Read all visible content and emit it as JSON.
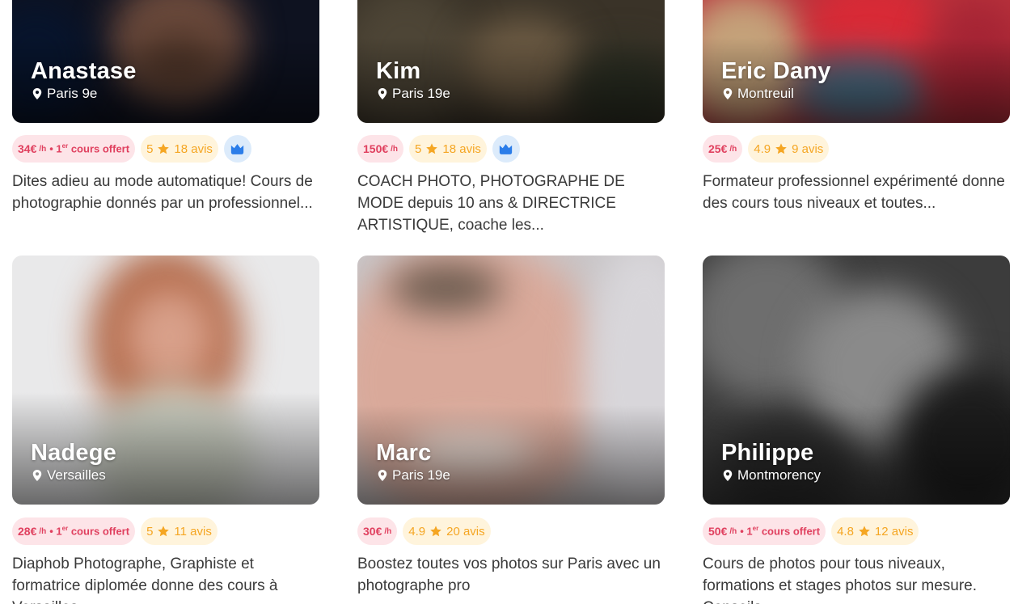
{
  "cards": [
    {
      "name": "Anastase",
      "location": "Paris 9e",
      "price": "34€",
      "per": "/h",
      "offer_prefix": "• 1",
      "offer_sup": "er",
      "offer_suffix": " cours offert",
      "rating": "5",
      "reviews": "18 avis",
      "badge": "crown-icon",
      "description": "Dites adieu au mode automatique! Cours de photographie donnés par un professionnel..."
    },
    {
      "name": "Kim",
      "location": "Paris 19e",
      "price": "150€",
      "per": "/h",
      "rating": "5",
      "reviews": "18 avis",
      "badge": "crown-icon",
      "description": "COACH PHOTO, PHOTOGRAPHE DE MODE depuis 10 ans & DIRECTRICE ARTISTIQUE, coache les..."
    },
    {
      "name": "Eric Dany",
      "location": "Montreuil",
      "price": "25€",
      "per": "/h",
      "rating": "4.9",
      "reviews": "9 avis",
      "description": "Formateur professionnel expérimenté donne des cours tous niveaux et toutes..."
    },
    {
      "name": "Nadege",
      "location": "Versailles",
      "price": "28€",
      "per": "/h",
      "offer_prefix": "• 1",
      "offer_sup": "er",
      "offer_suffix": " cours offert",
      "rating": "5",
      "reviews": "11 avis",
      "description": "Diaphob Photographe, Graphiste et formatrice diplomée donne des cours à Versailles..."
    },
    {
      "name": "Marc",
      "location": "Paris 19e",
      "price": "30€",
      "per": "/h",
      "rating": "4.9",
      "reviews": "20 avis",
      "description": "Boostez toutes vos photos sur Paris avec un photographe pro"
    },
    {
      "name": "Philippe",
      "location": "Montmorency",
      "price": "50€",
      "per": "/h",
      "offer_prefix": "• 1",
      "offer_sup": "er",
      "offer_suffix": " cours offert",
      "rating": "4.8",
      "reviews": "12 avis",
      "description": "Cours de photos pour tous niveaux, formations et stages photos sur mesure. Conseils..."
    }
  ],
  "colors": {
    "price_text": "#e0405f",
    "price_bg": "#fde4e8",
    "rating_text": "#f5a623",
    "rating_bg": "#fff4dc",
    "crown_bg": "#dcebfb",
    "crown": "#2b7de9"
  }
}
